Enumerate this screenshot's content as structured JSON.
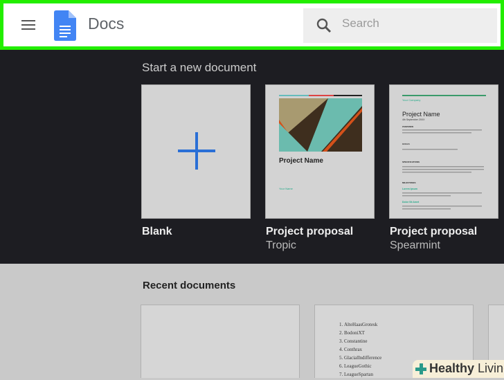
{
  "header": {
    "title": "Docs",
    "search_placeholder": "Search"
  },
  "templates": {
    "section_title": "Start a new document",
    "items": [
      {
        "label": "Blank",
        "sub": ""
      },
      {
        "label": "Project proposal",
        "sub": "Tropic",
        "doc_title": "Project Name",
        "doc_contact": "Your Name"
      },
      {
        "label": "Project proposal",
        "sub": "Spearmint",
        "doc_company": "Your Company",
        "doc_title": "Project Name",
        "doc_date": "4th September 20XX",
        "headings": [
          "OVERVIEW",
          "GOALS",
          "SPECIFICATIONS",
          "MILESTONES"
        ],
        "milestones": [
          "Lorem Ipsum",
          "Dolor Sit Amet"
        ]
      }
    ]
  },
  "recent": {
    "section_title": "Recent documents",
    "list": [
      "AlteHaasGrotesk",
      "BodoniXT",
      "Constantine",
      "Conthrax",
      "GlacialIndifference",
      "LeagueGothic",
      "LeagueSpartan"
    ]
  },
  "watermark": {
    "text_bold": "Healthy",
    "text": "Living"
  },
  "colors": {
    "highlight": "#22ee00",
    "accent": "#2a6fd6",
    "dark_bg": "#1d1d22"
  }
}
